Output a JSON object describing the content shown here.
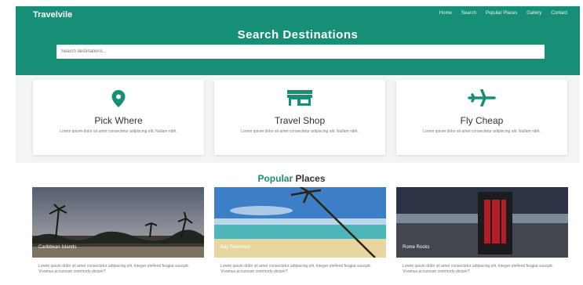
{
  "brand": "Travelvile",
  "nav": [
    "Home",
    "Search",
    "Popular Places",
    "Gallery",
    "Contact"
  ],
  "hero": {
    "title": "Search Destinations",
    "search_placeholder": "Search destinations..."
  },
  "features": [
    {
      "title": "Pick Where",
      "icon": "map-marker-icon",
      "desc": "Lorem ipsum dolor sit amet consectetur adipiscing elit. Nullam nibh."
    },
    {
      "title": "Travel Shop",
      "icon": "shop-icon",
      "desc": "Lorem ipsum dolor sit amet consectetur adipiscing elit. Nullam nibh."
    },
    {
      "title": "Fly Cheap",
      "icon": "airplane-icon",
      "desc": "Lorem ipsum dolor sit amet consectetur adipiscing elit. Nullam nibh."
    }
  ],
  "popular": {
    "part1": "Popular",
    "part2": "Places"
  },
  "places": [
    {
      "caption": "Caribbean Islands",
      "desc": "Lorem ipsum dolor sit amet consectetur adipiscing elit. Integer eleifend feugiat suscipit. Vivamus accumsan commodo dictum?"
    },
    {
      "caption": "Bay Seashore",
      "desc": "Lorem ipsum dolor sit amet consectetur adipiscing elit. Integer eleifend feugiat suscipit. Vivamus accumsan commodo dictum?"
    },
    {
      "caption": "Rome Rocks",
      "desc": "Lorem ipsum dolor sit amet consectetur adipiscing elit. Integer eleifend feugiat suscipit. Vivamus accumsan commodo dictum?"
    }
  ],
  "colors": {
    "primary": "#168f76",
    "section_bg": "#f3f4f4"
  }
}
